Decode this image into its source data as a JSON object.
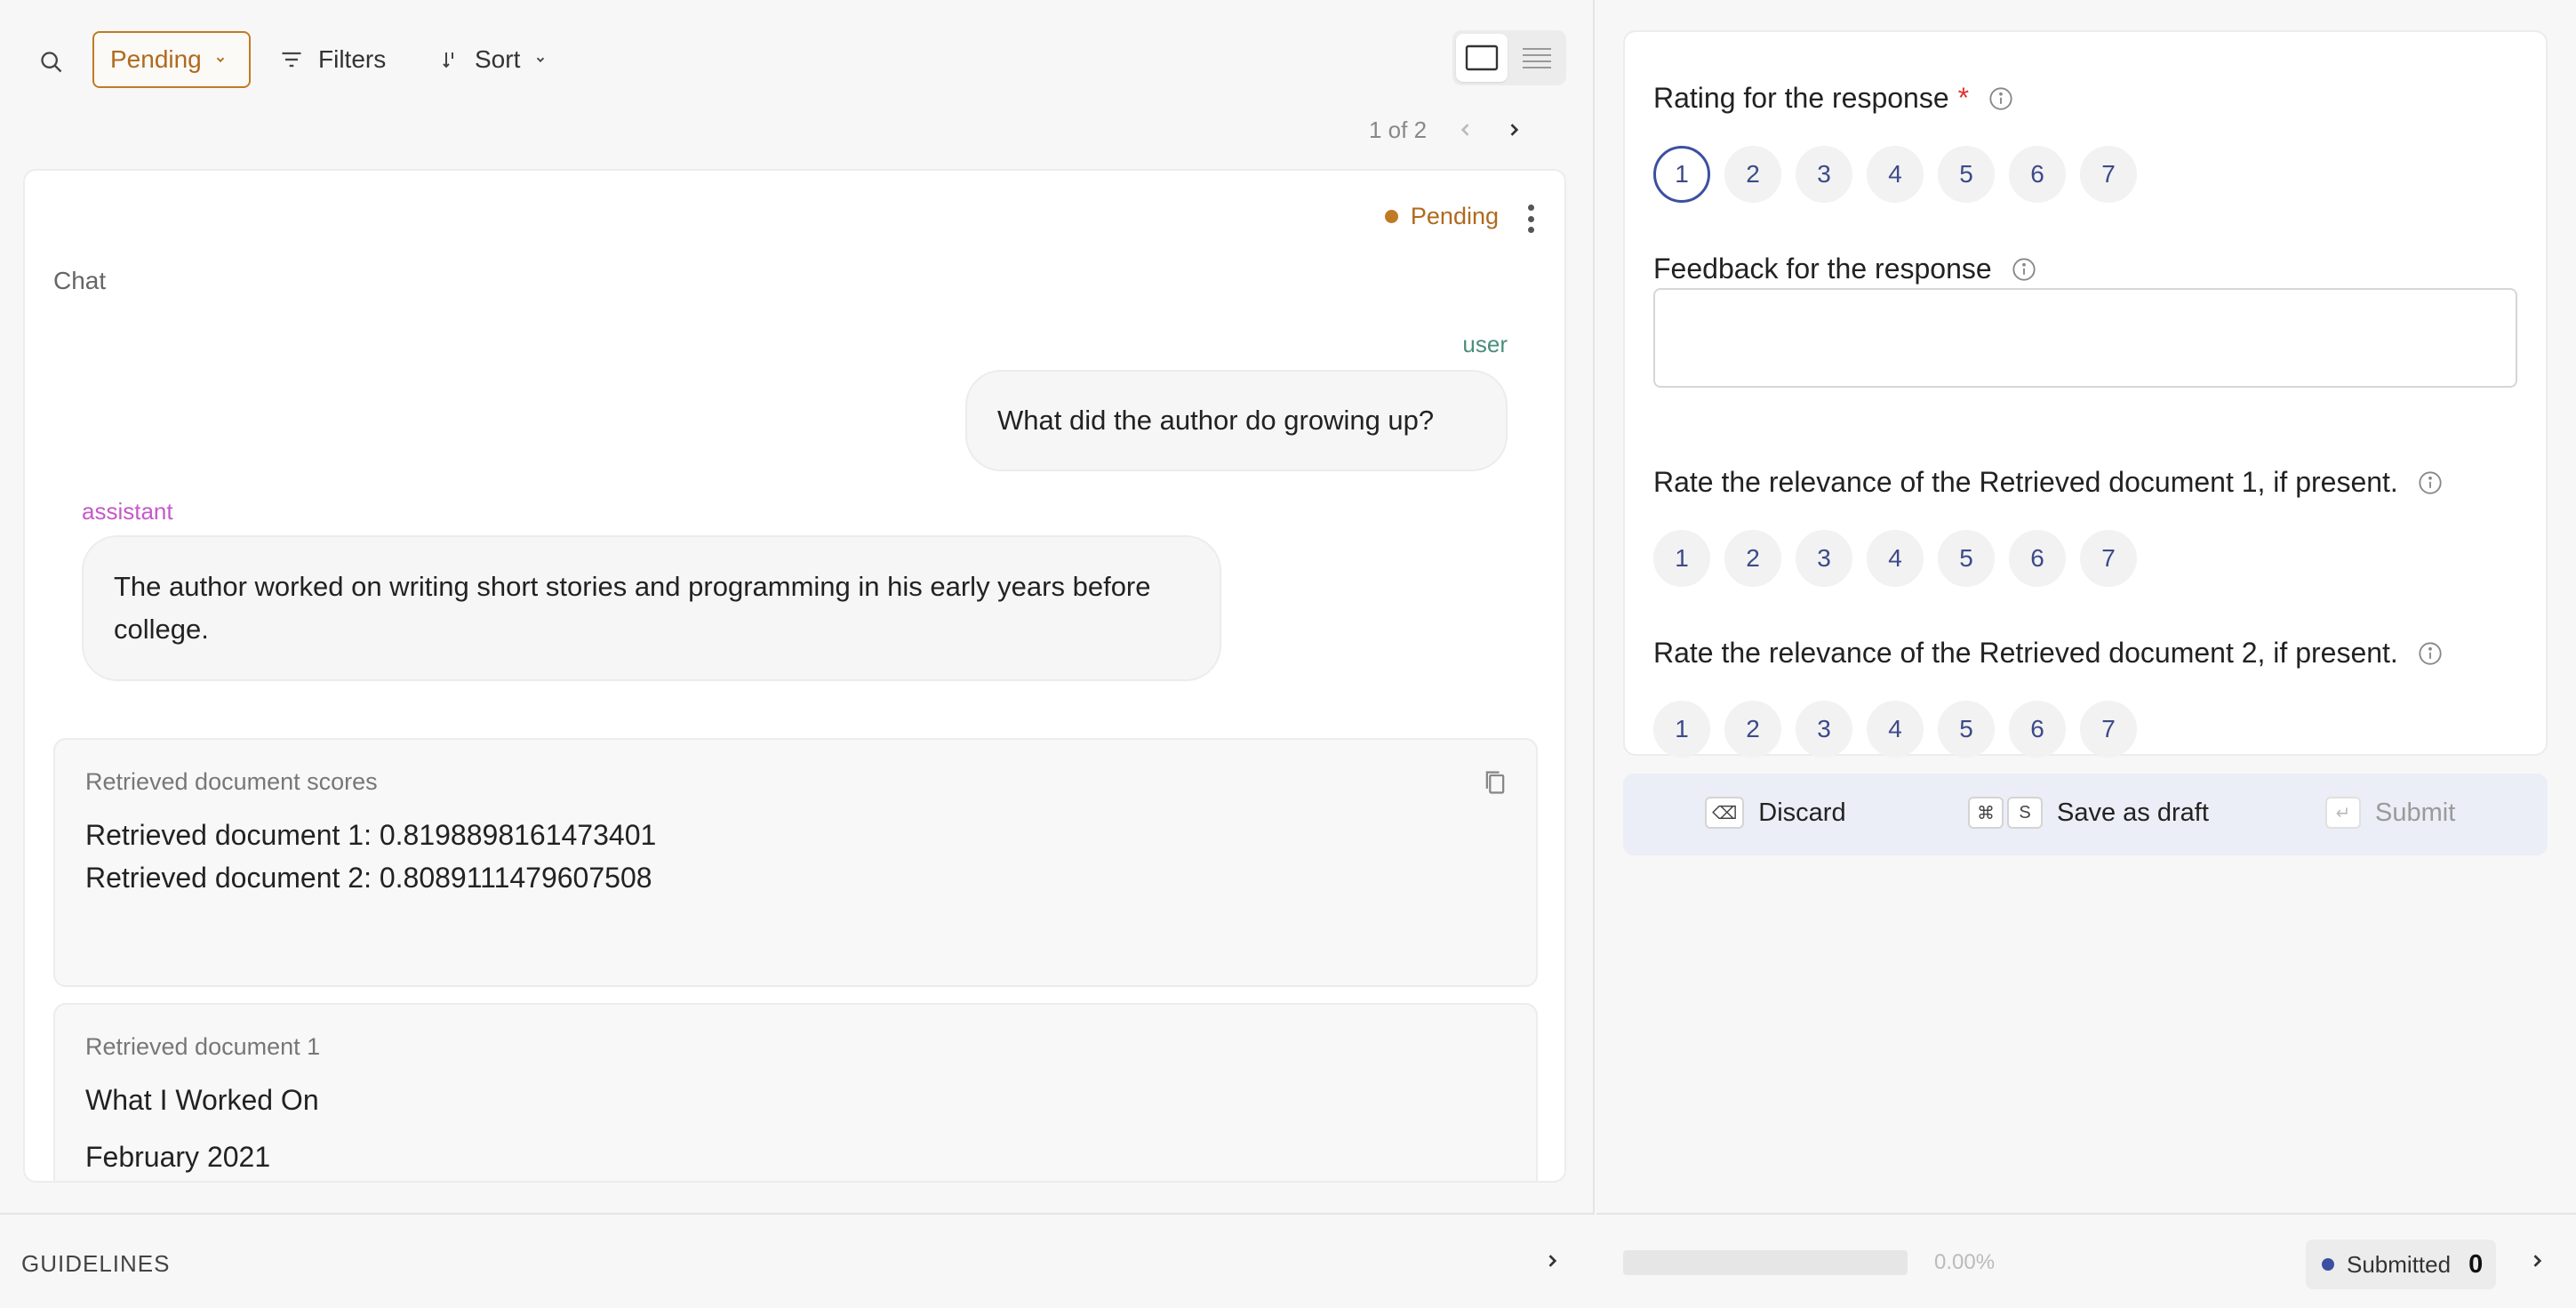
{
  "toolbar": {
    "status_filter": "Pending",
    "filters_label": "Filters",
    "sort_label": "Sort"
  },
  "pager": {
    "text": "1 of 2"
  },
  "record": {
    "status": "Pending",
    "chat_label": "Chat",
    "messages": [
      {
        "role": "user",
        "text": "What did the author do growing up?"
      },
      {
        "role": "assistant",
        "text": "The author worked on writing short stories and programming in his early years before college."
      }
    ],
    "scores_title": "Retrieved document scores",
    "scores": [
      "Retrieved document 1: 0.8198898161473401",
      "Retrieved document 2: 0.8089111479607508"
    ],
    "doc1_title": "Retrieved document 1",
    "doc1_lines": [
      "What I Worked On",
      "February 2021"
    ]
  },
  "guidelines": {
    "label": "GUIDELINES"
  },
  "form": {
    "questions": [
      {
        "label": "Rating for the response",
        "required": "*",
        "options": [
          "1",
          "2",
          "3",
          "4",
          "5",
          "6",
          "7"
        ],
        "selected": "1"
      },
      {
        "label": "Feedback for the response"
      },
      {
        "label": "Rate the relevance of the Retrieved document 1, if present.",
        "options": [
          "1",
          "2",
          "3",
          "4",
          "5",
          "6",
          "7"
        ]
      },
      {
        "label": "Rate the relevance of the Retrieved document 2, if present.",
        "options": [
          "1",
          "2",
          "3",
          "4",
          "5",
          "6",
          "7"
        ]
      }
    ]
  },
  "actions": {
    "discard": {
      "label": "Discard",
      "key": "⌫"
    },
    "save_draft": {
      "label": "Save as draft",
      "keys": [
        "⌘",
        "S"
      ]
    },
    "submit": {
      "label": "Submit",
      "key": "↵"
    }
  },
  "progress": {
    "value": 0,
    "text": "0.00%"
  },
  "submitted": {
    "label": "Submitted",
    "count": "0"
  },
  "colors": {
    "accent": "#3d4fa0",
    "pending": "#c07a26",
    "user_role": "#4a8f7b",
    "assistant_role": "#c55ac9"
  }
}
